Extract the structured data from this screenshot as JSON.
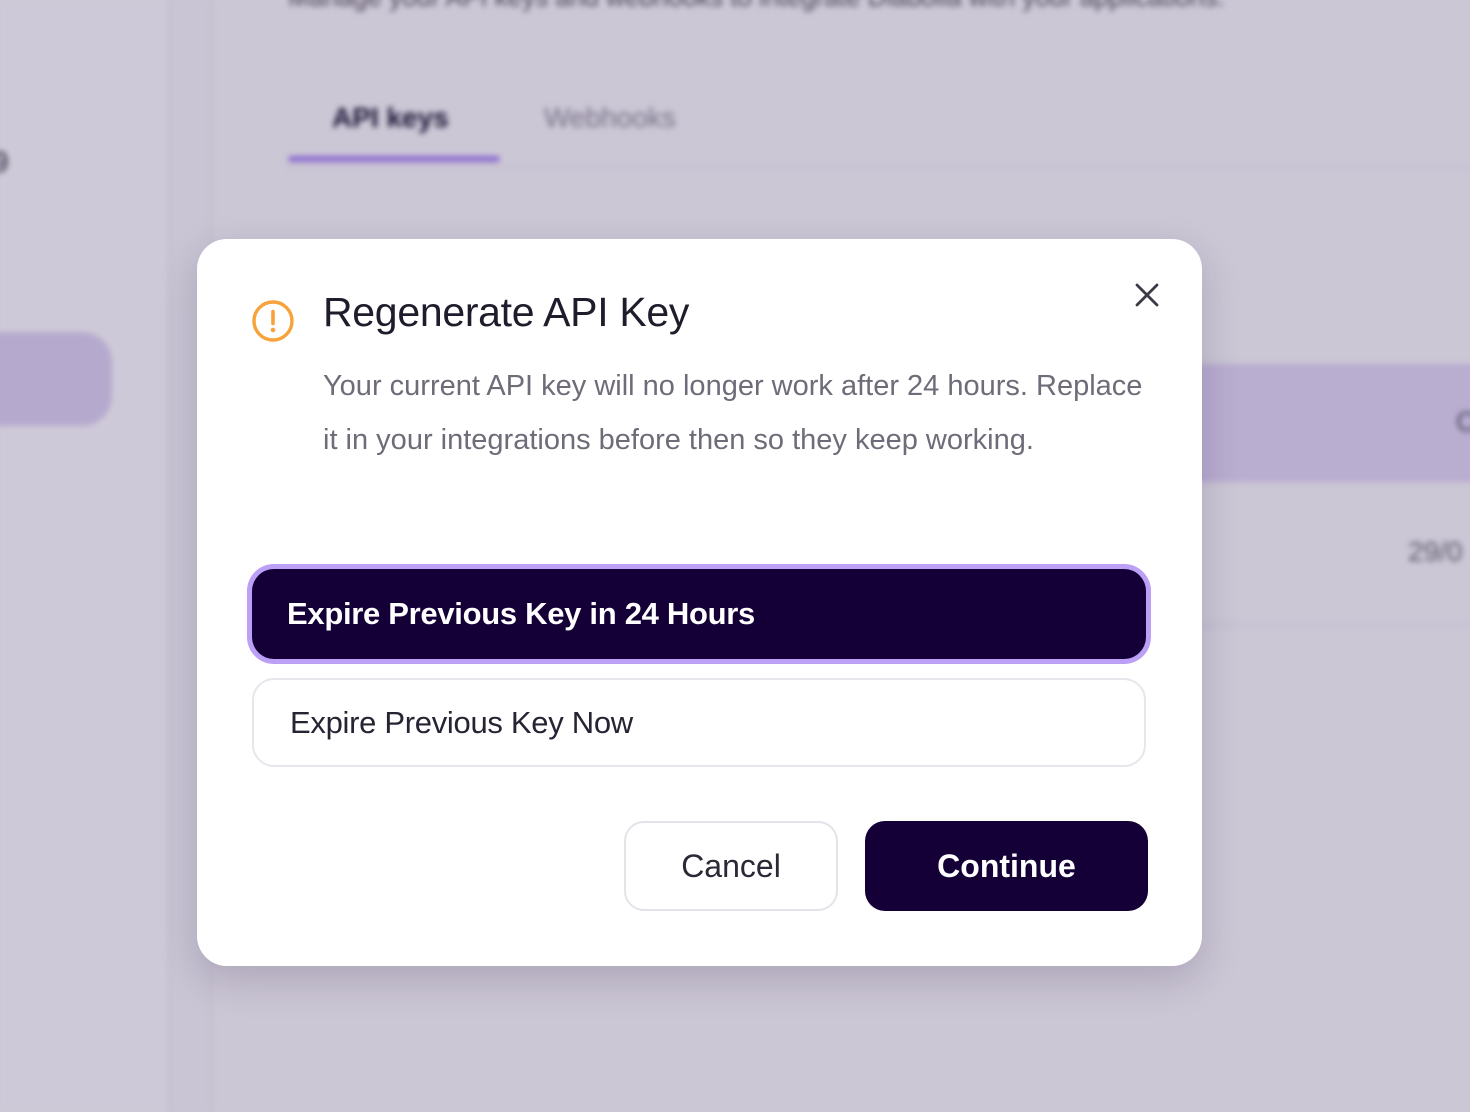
{
  "background": {
    "sidebar_text": "9",
    "subtitle": "Manage your API keys and webhooks to integrate Diabolia with your applications.",
    "tabs": [
      {
        "label": "API keys",
        "active": true
      },
      {
        "label": "Webhooks",
        "active": false
      }
    ],
    "table_header_text": "C",
    "table_cell_text": "29/0"
  },
  "modal": {
    "icon": "warning-circle-icon",
    "title": "Regenerate API Key",
    "description": "Your current API key will no longer work after 24 hours. Replace it in your integrations before then so they keep working.",
    "options": [
      {
        "label": "Expire Previous Key in 24 Hours",
        "selected": true
      },
      {
        "label": "Expire Previous Key Now",
        "selected": false
      }
    ],
    "cancel_label": "Cancel",
    "continue_label": "Continue",
    "close_icon": "close-icon"
  },
  "colors": {
    "primary_dark": "#140037",
    "selection_ring": "#bba0f5",
    "warning": "#f7a23b",
    "tab_underline": "#a47ff0"
  }
}
